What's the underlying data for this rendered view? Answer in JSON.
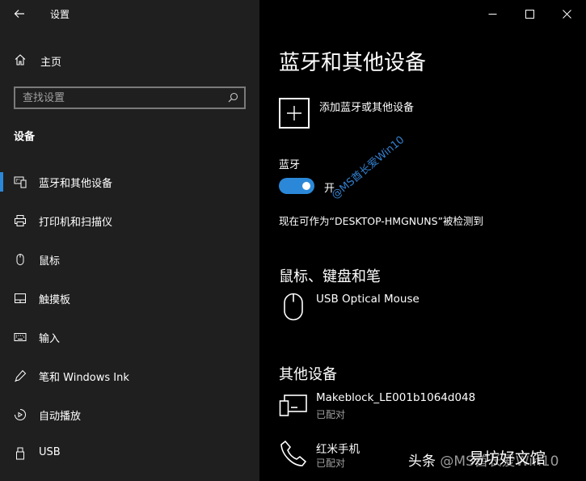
{
  "window": {
    "title": "设置"
  },
  "sidebar": {
    "home_label": "主页",
    "search_placeholder": "查找设置",
    "section_title": "设备",
    "items": [
      {
        "label": "蓝牙和其他设备",
        "icon": "bluetooth-devices-icon",
        "active": true
      },
      {
        "label": "打印机和扫描仪",
        "icon": "printer-icon"
      },
      {
        "label": "鼠标",
        "icon": "mouse-icon"
      },
      {
        "label": "触摸板",
        "icon": "touchpad-icon"
      },
      {
        "label": "输入",
        "icon": "keyboard-icon"
      },
      {
        "label": "笔和 Windows Ink",
        "icon": "pen-icon"
      },
      {
        "label": "自动播放",
        "icon": "autoplay-icon"
      },
      {
        "label": "USB",
        "icon": "usb-icon"
      }
    ]
  },
  "main": {
    "title": "蓝牙和其他设备",
    "add_device_label": "添加蓝牙或其他设备",
    "bluetooth_label": "蓝牙",
    "bluetooth_state": "开",
    "bluetooth_on": true,
    "discoverable_text": "现在可作为“DESKTOP-HMGNUNS”被检测到",
    "mouse_section": {
      "title": "鼠标、键盘和笔",
      "devices": [
        {
          "name": "USB Optical Mouse",
          "icon": "mouse-icon"
        }
      ]
    },
    "other_section": {
      "title": "其他设备",
      "devices": [
        {
          "name": "Makeblock_LE001b1064d048",
          "status": "已配对",
          "icon": "display-device-icon"
        },
        {
          "name": "红米手机",
          "status": "已配对",
          "icon": "phone-icon"
        }
      ]
    }
  },
  "watermark": {
    "diagonal": "@MS酋长爱Win10",
    "bottom_brand": "头条",
    "bottom_handle": "@MS酋长爱Win10",
    "bottom_site": "易坊好文馆"
  },
  "colors": {
    "accent": "#2b88d8",
    "sidebar_bg": "#1f1f1f",
    "content_bg": "#000000",
    "secondary_text": "#a0a0a0"
  }
}
